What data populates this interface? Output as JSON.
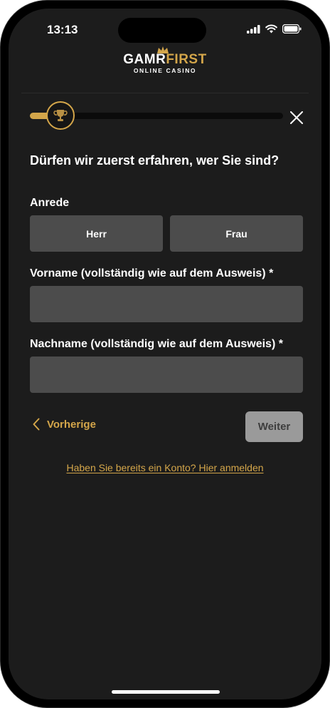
{
  "status_bar": {
    "time": "13:13",
    "icons": [
      "cellular-signal-icon",
      "wifi-icon",
      "battery-icon"
    ]
  },
  "brand": {
    "logo_part1": "GAMR",
    "logo_part2": "FIRST",
    "tagline": "ONLINE CASINO",
    "accent_color": "#d4a64a"
  },
  "progress": {
    "fraction": 0.12,
    "knob_icon": "trophy-icon"
  },
  "form": {
    "question": "Dürfen wir zuerst erfahren, wer Sie sind?",
    "salutation_label": "Anrede",
    "salutation_options": [
      "Herr",
      "Frau"
    ],
    "first_name_label": "Vorname (vollständig wie auf dem Ausweis) *",
    "first_name_value": "",
    "last_name_label": "Nachname (vollständig wie auf dem Ausweis) *",
    "last_name_value": ""
  },
  "navigation": {
    "previous_label": "Vorherige",
    "next_label": "Weiter",
    "login_link": "Haben Sie bereits ein Konto? Hier anmelden"
  },
  "colors": {
    "background": "#1c1c1c",
    "field": "#4c4c4c",
    "next_disabled": "#9a9a9a"
  }
}
